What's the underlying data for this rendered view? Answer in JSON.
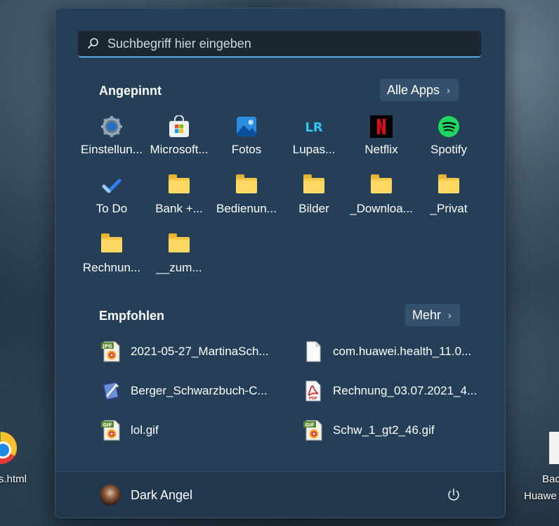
{
  "desktop": {
    "left_item_label": "s.html",
    "right_item_label_1": "Bac",
    "right_item_label_2": "Huawe"
  },
  "search": {
    "placeholder": "Suchbegriff hier eingeben"
  },
  "pinned": {
    "title": "Angepinnt",
    "all_apps_label": "Alle Apps",
    "apps": [
      {
        "label": "Einstellun...",
        "icon": "settings-icon"
      },
      {
        "label": "Microsoft...",
        "icon": "store-icon"
      },
      {
        "label": "Fotos",
        "icon": "photos-icon"
      },
      {
        "label": "Lupas...",
        "icon": "lightroom-icon"
      },
      {
        "label": "Netflix",
        "icon": "netflix-icon"
      },
      {
        "label": "Spotify",
        "icon": "spotify-icon"
      },
      {
        "label": "To Do",
        "icon": "todo-icon"
      },
      {
        "label": "Bank +...",
        "icon": "folder-icon"
      },
      {
        "label": "Bedienun...",
        "icon": "folder-icon"
      },
      {
        "label": "Bilder",
        "icon": "folder-icon"
      },
      {
        "label": "_Downloa...",
        "icon": "folder-icon"
      },
      {
        "label": "_Privat",
        "icon": "folder-icon"
      },
      {
        "label": "Rechnun...",
        "icon": "folder-icon"
      },
      {
        "label": "__zum...",
        "icon": "folder-icon"
      }
    ]
  },
  "recommended": {
    "title": "Empfohlen",
    "more_label": "Mehr",
    "items": [
      {
        "label": "2021-05-27_MartinaSch...",
        "icon": "jpg-file-icon"
      },
      {
        "label": "com.huawei.health_11.0...",
        "icon": "file-icon"
      },
      {
        "label": "Berger_Schwarzbuch-C...",
        "icon": "ebook-file-icon"
      },
      {
        "label": "Rechnung_03.07.2021_4...",
        "icon": "pdf-file-icon"
      },
      {
        "label": "lol.gif",
        "icon": "gif-file-icon"
      },
      {
        "label": "Schw_1_gt2_46.gif",
        "icon": "gif-file-icon"
      }
    ]
  },
  "user": {
    "name": "Dark Angel"
  },
  "colors": {
    "accent": "#5aa6e8",
    "panel": "#243f57"
  }
}
